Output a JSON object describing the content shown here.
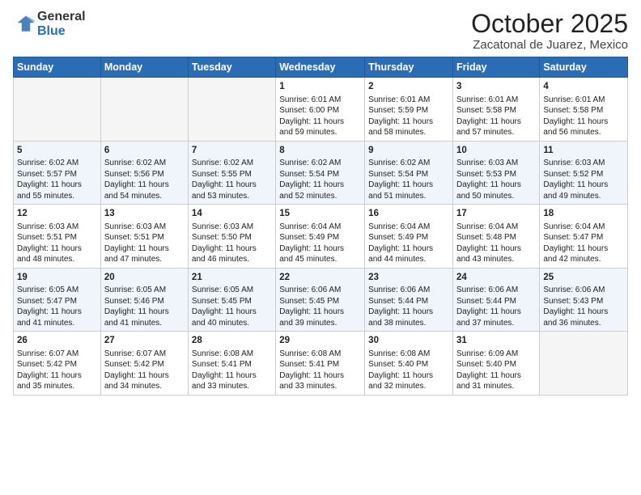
{
  "logo": {
    "general": "General",
    "blue": "Blue"
  },
  "header": {
    "month": "October 2025",
    "location": "Zacatonal de Juarez, Mexico"
  },
  "weekdays": [
    "Sunday",
    "Monday",
    "Tuesday",
    "Wednesday",
    "Thursday",
    "Friday",
    "Saturday"
  ],
  "weeks": [
    [
      {
        "day": "",
        "info": ""
      },
      {
        "day": "",
        "info": ""
      },
      {
        "day": "",
        "info": ""
      },
      {
        "day": "1",
        "info": "Sunrise: 6:01 AM\nSunset: 6:00 PM\nDaylight: 11 hours\nand 59 minutes."
      },
      {
        "day": "2",
        "info": "Sunrise: 6:01 AM\nSunset: 5:59 PM\nDaylight: 11 hours\nand 58 minutes."
      },
      {
        "day": "3",
        "info": "Sunrise: 6:01 AM\nSunset: 5:58 PM\nDaylight: 11 hours\nand 57 minutes."
      },
      {
        "day": "4",
        "info": "Sunrise: 6:01 AM\nSunset: 5:58 PM\nDaylight: 11 hours\nand 56 minutes."
      }
    ],
    [
      {
        "day": "5",
        "info": "Sunrise: 6:02 AM\nSunset: 5:57 PM\nDaylight: 11 hours\nand 55 minutes."
      },
      {
        "day": "6",
        "info": "Sunrise: 6:02 AM\nSunset: 5:56 PM\nDaylight: 11 hours\nand 54 minutes."
      },
      {
        "day": "7",
        "info": "Sunrise: 6:02 AM\nSunset: 5:55 PM\nDaylight: 11 hours\nand 53 minutes."
      },
      {
        "day": "8",
        "info": "Sunrise: 6:02 AM\nSunset: 5:54 PM\nDaylight: 11 hours\nand 52 minutes."
      },
      {
        "day": "9",
        "info": "Sunrise: 6:02 AM\nSunset: 5:54 PM\nDaylight: 11 hours\nand 51 minutes."
      },
      {
        "day": "10",
        "info": "Sunrise: 6:03 AM\nSunset: 5:53 PM\nDaylight: 11 hours\nand 50 minutes."
      },
      {
        "day": "11",
        "info": "Sunrise: 6:03 AM\nSunset: 5:52 PM\nDaylight: 11 hours\nand 49 minutes."
      }
    ],
    [
      {
        "day": "12",
        "info": "Sunrise: 6:03 AM\nSunset: 5:51 PM\nDaylight: 11 hours\nand 48 minutes."
      },
      {
        "day": "13",
        "info": "Sunrise: 6:03 AM\nSunset: 5:51 PM\nDaylight: 11 hours\nand 47 minutes."
      },
      {
        "day": "14",
        "info": "Sunrise: 6:03 AM\nSunset: 5:50 PM\nDaylight: 11 hours\nand 46 minutes."
      },
      {
        "day": "15",
        "info": "Sunrise: 6:04 AM\nSunset: 5:49 PM\nDaylight: 11 hours\nand 45 minutes."
      },
      {
        "day": "16",
        "info": "Sunrise: 6:04 AM\nSunset: 5:49 PM\nDaylight: 11 hours\nand 44 minutes."
      },
      {
        "day": "17",
        "info": "Sunrise: 6:04 AM\nSunset: 5:48 PM\nDaylight: 11 hours\nand 43 minutes."
      },
      {
        "day": "18",
        "info": "Sunrise: 6:04 AM\nSunset: 5:47 PM\nDaylight: 11 hours\nand 42 minutes."
      }
    ],
    [
      {
        "day": "19",
        "info": "Sunrise: 6:05 AM\nSunset: 5:47 PM\nDaylight: 11 hours\nand 41 minutes."
      },
      {
        "day": "20",
        "info": "Sunrise: 6:05 AM\nSunset: 5:46 PM\nDaylight: 11 hours\nand 41 minutes."
      },
      {
        "day": "21",
        "info": "Sunrise: 6:05 AM\nSunset: 5:45 PM\nDaylight: 11 hours\nand 40 minutes."
      },
      {
        "day": "22",
        "info": "Sunrise: 6:06 AM\nSunset: 5:45 PM\nDaylight: 11 hours\nand 39 minutes."
      },
      {
        "day": "23",
        "info": "Sunrise: 6:06 AM\nSunset: 5:44 PM\nDaylight: 11 hours\nand 38 minutes."
      },
      {
        "day": "24",
        "info": "Sunrise: 6:06 AM\nSunset: 5:44 PM\nDaylight: 11 hours\nand 37 minutes."
      },
      {
        "day": "25",
        "info": "Sunrise: 6:06 AM\nSunset: 5:43 PM\nDaylight: 11 hours\nand 36 minutes."
      }
    ],
    [
      {
        "day": "26",
        "info": "Sunrise: 6:07 AM\nSunset: 5:42 PM\nDaylight: 11 hours\nand 35 minutes."
      },
      {
        "day": "27",
        "info": "Sunrise: 6:07 AM\nSunset: 5:42 PM\nDaylight: 11 hours\nand 34 minutes."
      },
      {
        "day": "28",
        "info": "Sunrise: 6:08 AM\nSunset: 5:41 PM\nDaylight: 11 hours\nand 33 minutes."
      },
      {
        "day": "29",
        "info": "Sunrise: 6:08 AM\nSunset: 5:41 PM\nDaylight: 11 hours\nand 33 minutes."
      },
      {
        "day": "30",
        "info": "Sunrise: 6:08 AM\nSunset: 5:40 PM\nDaylight: 11 hours\nand 32 minutes."
      },
      {
        "day": "31",
        "info": "Sunrise: 6:09 AM\nSunset: 5:40 PM\nDaylight: 11 hours\nand 31 minutes."
      },
      {
        "day": "",
        "info": ""
      }
    ]
  ]
}
